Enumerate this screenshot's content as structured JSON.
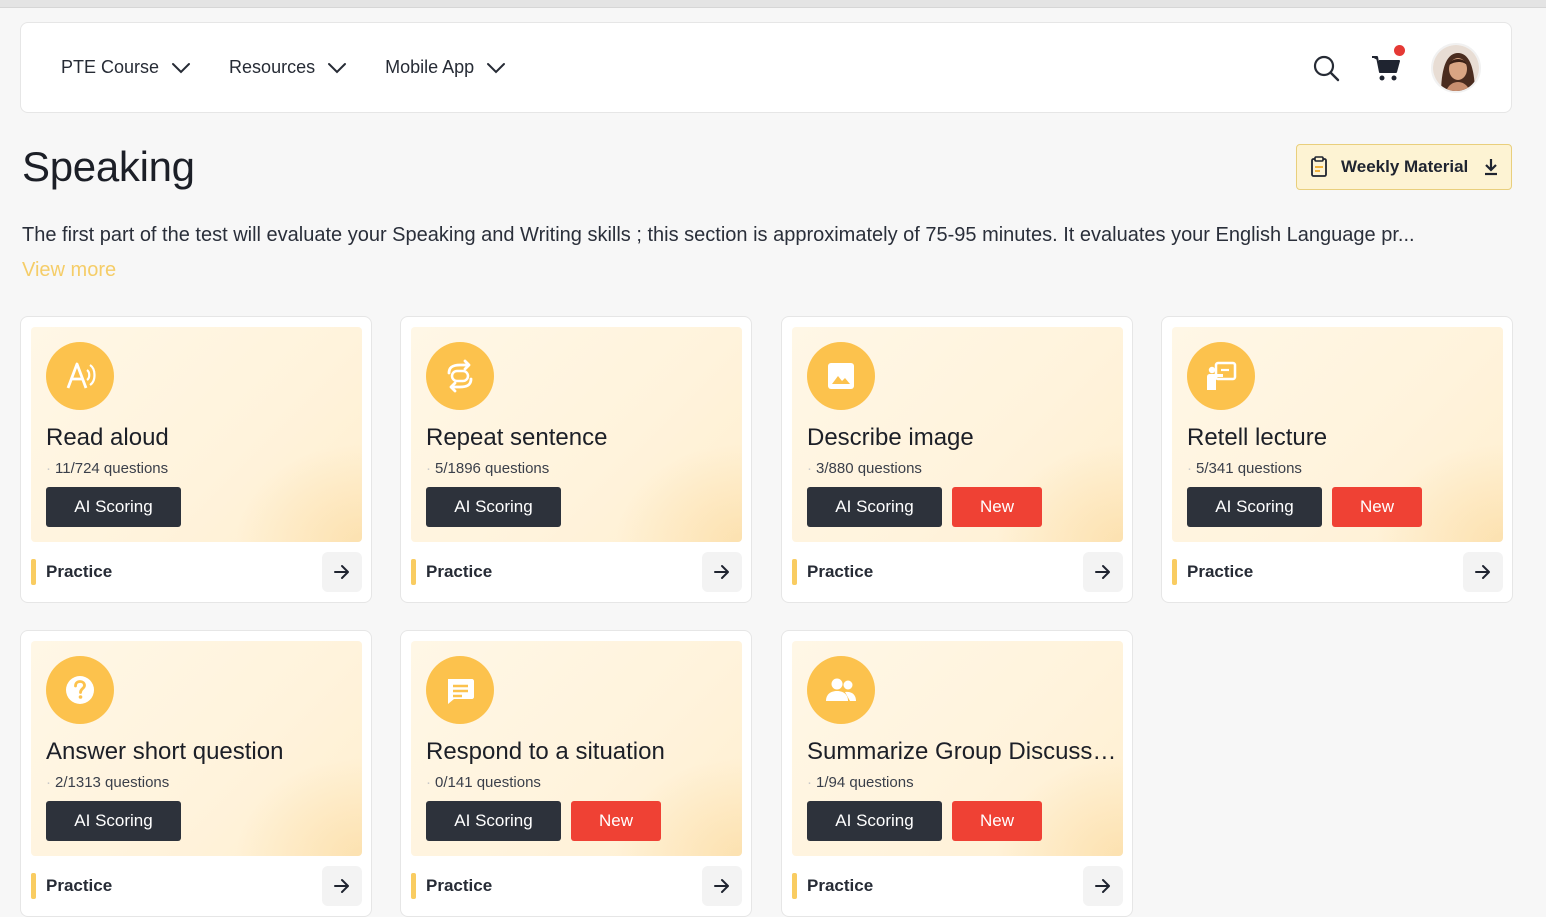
{
  "nav": {
    "items": [
      {
        "label": "PTE Course"
      },
      {
        "label": "Resources"
      },
      {
        "label": "Mobile App"
      }
    ]
  },
  "header": {
    "search_icon": "search-icon",
    "cart_icon": "cart-icon",
    "notification_color": "#e53935"
  },
  "page": {
    "title": "Speaking",
    "weekly_material": "Weekly Material",
    "description": "The first part of the test will evaluate your Speaking and Writing skills ; this section is approximately of 75-95 minutes. It evaluates your English Language pr...",
    "view_more": "View more"
  },
  "cards": [
    {
      "title": "Read aloud",
      "count": "11/724 questions",
      "ai": "AI Scoring",
      "new": "",
      "practice": "Practice",
      "icon": "read-aloud-icon"
    },
    {
      "title": "Repeat sentence",
      "count": "5/1896 questions",
      "ai": "AI Scoring",
      "new": "",
      "practice": "Practice",
      "icon": "repeat-icon"
    },
    {
      "title": "Describe image",
      "count": "3/880 questions",
      "ai": "AI Scoring",
      "new": "New",
      "practice": "Practice",
      "icon": "image-icon"
    },
    {
      "title": "Retell lecture",
      "count": "5/341 questions",
      "ai": "AI Scoring",
      "new": "New",
      "practice": "Practice",
      "icon": "lecture-icon"
    },
    {
      "title": "Answer short question",
      "count": "2/1313 questions",
      "ai": "AI Scoring",
      "new": "",
      "practice": "Practice",
      "icon": "question-icon"
    },
    {
      "title": "Respond to a situation",
      "count": "0/141 questions",
      "ai": "AI Scoring",
      "new": "New",
      "practice": "Practice",
      "icon": "chat-icon"
    },
    {
      "title": "Summarize Group Discussion",
      "count": "1/94 questions",
      "ai": "AI Scoring",
      "new": "New",
      "practice": "Practice",
      "icon": "group-icon"
    }
  ],
  "colors": {
    "accent": "#fcc24d",
    "ai_tag": "#2d323b",
    "new_tag": "#ef4134",
    "view_more": "#f5cd68"
  }
}
